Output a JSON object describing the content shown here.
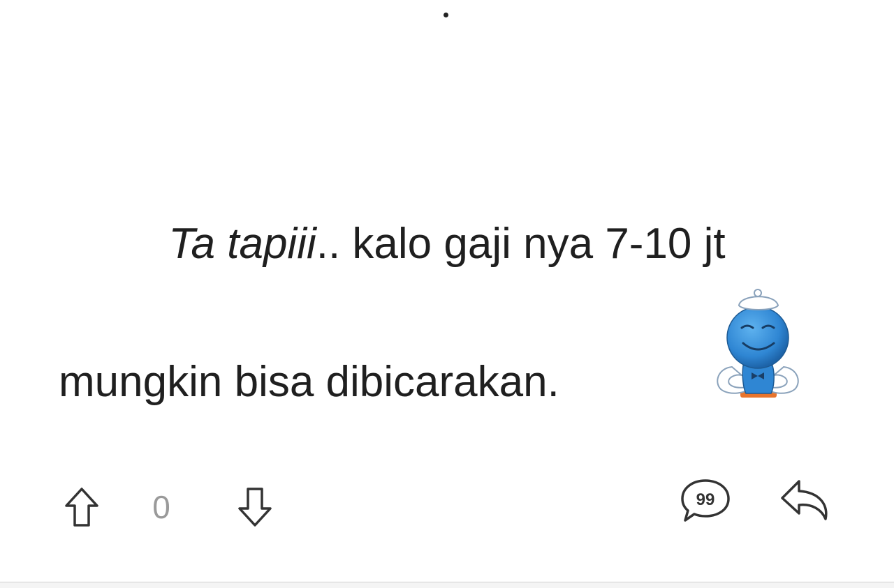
{
  "post": {
    "text_italic": "Ta tapiii",
    "text_line1_rest": ".. kalo gaji nya 7-10 jt",
    "text_line2": "mungkin bisa dibicarakan.",
    "sticker_icon": "blue-emoticon-sticker-icon"
  },
  "actions": {
    "upvote_icon": "arrow-up-icon",
    "vote_count": "0",
    "downvote_icon": "arrow-down-icon",
    "quote_icon": "quote-bubble-icon",
    "quote_label": "99",
    "reply_icon": "reply-arrow-icon"
  },
  "colors": {
    "text": "#1f1f1f",
    "vote_count": "#9a9a9a",
    "icon_stroke": "#333333",
    "sticker_blue": "#2f86d3"
  }
}
